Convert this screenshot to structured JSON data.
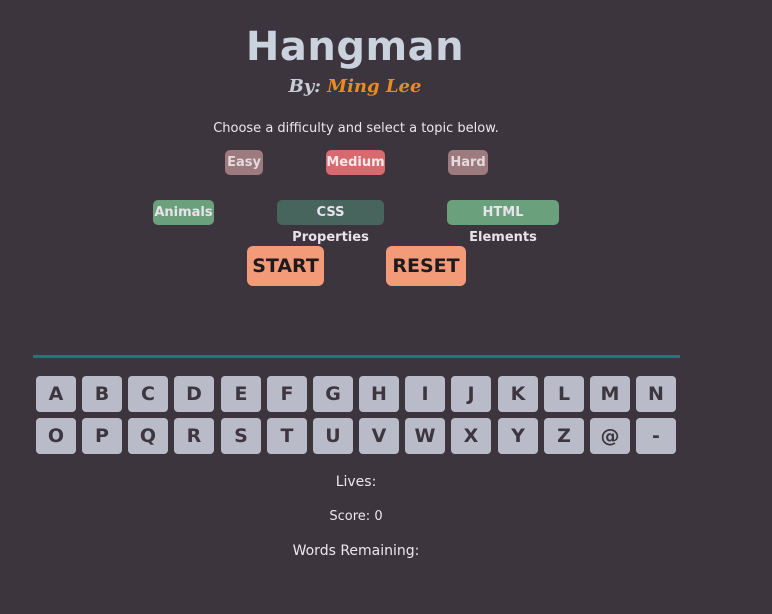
{
  "header": {
    "title": "Hangman",
    "by_prefix": "By:",
    "author": "Ming Lee"
  },
  "instructions": "Choose a difficulty and select a topic below.",
  "difficulty": {
    "easy": "Easy",
    "medium": "Medium",
    "hard": "Hard",
    "selected": "Medium"
  },
  "topics": {
    "animals": "Animals",
    "css": "CSS Properties",
    "html": "HTML Elements",
    "selected": "CSS Properties"
  },
  "actions": {
    "start": "START",
    "reset": "RESET"
  },
  "keyboard": {
    "row1": [
      "A",
      "B",
      "C",
      "D",
      "E",
      "F",
      "G",
      "H",
      "I",
      "J",
      "K",
      "L",
      "M",
      "N"
    ],
    "row2": [
      "O",
      "P",
      "Q",
      "R",
      "S",
      "T",
      "U",
      "V",
      "W",
      "X",
      "Y",
      "Z",
      "@",
      "-"
    ]
  },
  "stats": {
    "lives_label": "Lives:",
    "score_label": "Score: 0",
    "words_remaining_label": "Words Remaining:"
  },
  "colors": {
    "background": "#3d353d",
    "accent_action": "#f39a78",
    "difficulty_selected": "#d66a6f",
    "difficulty_unselected": "#9c7a7e",
    "topic_unselected": "#6aa07c",
    "topic_selected": "#47655c",
    "divider": "#1f7878",
    "key": "#b9bcc8",
    "author": "#e98b20"
  }
}
